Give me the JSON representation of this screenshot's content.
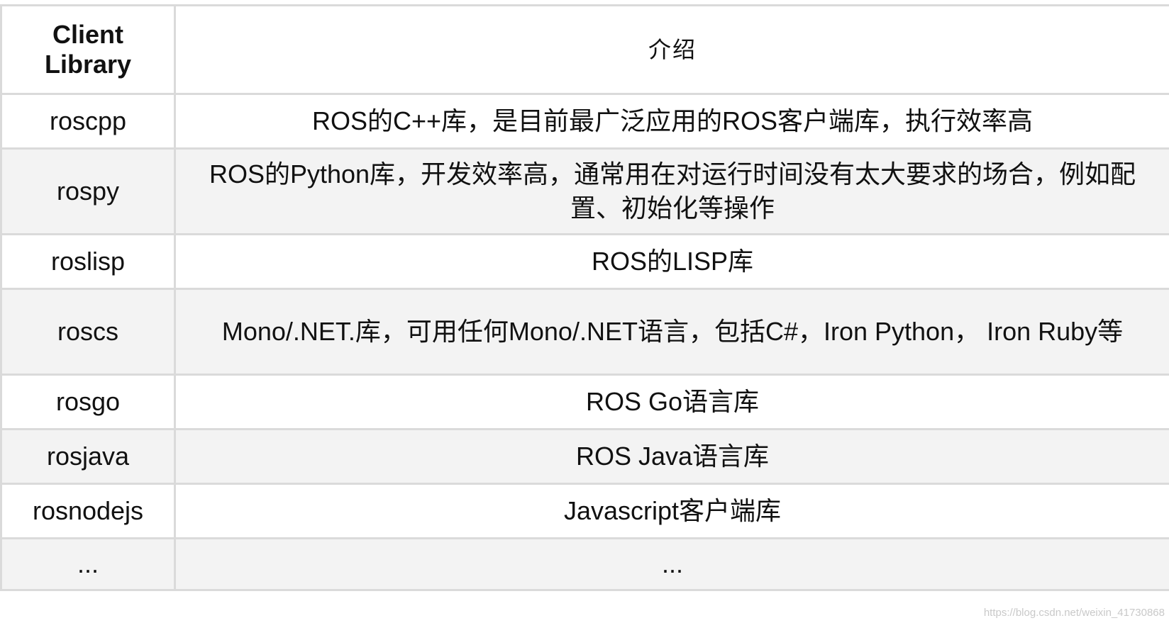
{
  "table": {
    "headers": [
      "Client Library",
      "介绍"
    ],
    "rows": [
      {
        "name": "roscpp",
        "desc": "ROS的C++库，是目前最广泛应用的ROS客户端库，执行效率高"
      },
      {
        "name": "rospy",
        "desc": "ROS的Python库，开发效率高，通常用在对运行时间没有太大要求的场合，例如配置、初始化等操作"
      },
      {
        "name": "roslisp",
        "desc": "ROS的LISP库"
      },
      {
        "name": "roscs",
        "desc": "Mono/.NET.库，可用任何Mono/.NET语言，包括C#，Iron Python， Iron Ruby等"
      },
      {
        "name": "rosgo",
        "desc": "ROS Go语言库"
      },
      {
        "name": "rosjava",
        "desc": "ROS Java语言库"
      },
      {
        "name": "rosnodejs",
        "desc": "Javascript客户端库"
      },
      {
        "name": "...",
        "desc": "..."
      }
    ]
  },
  "watermark": "https://blog.csdn.net/weixin_41730868"
}
